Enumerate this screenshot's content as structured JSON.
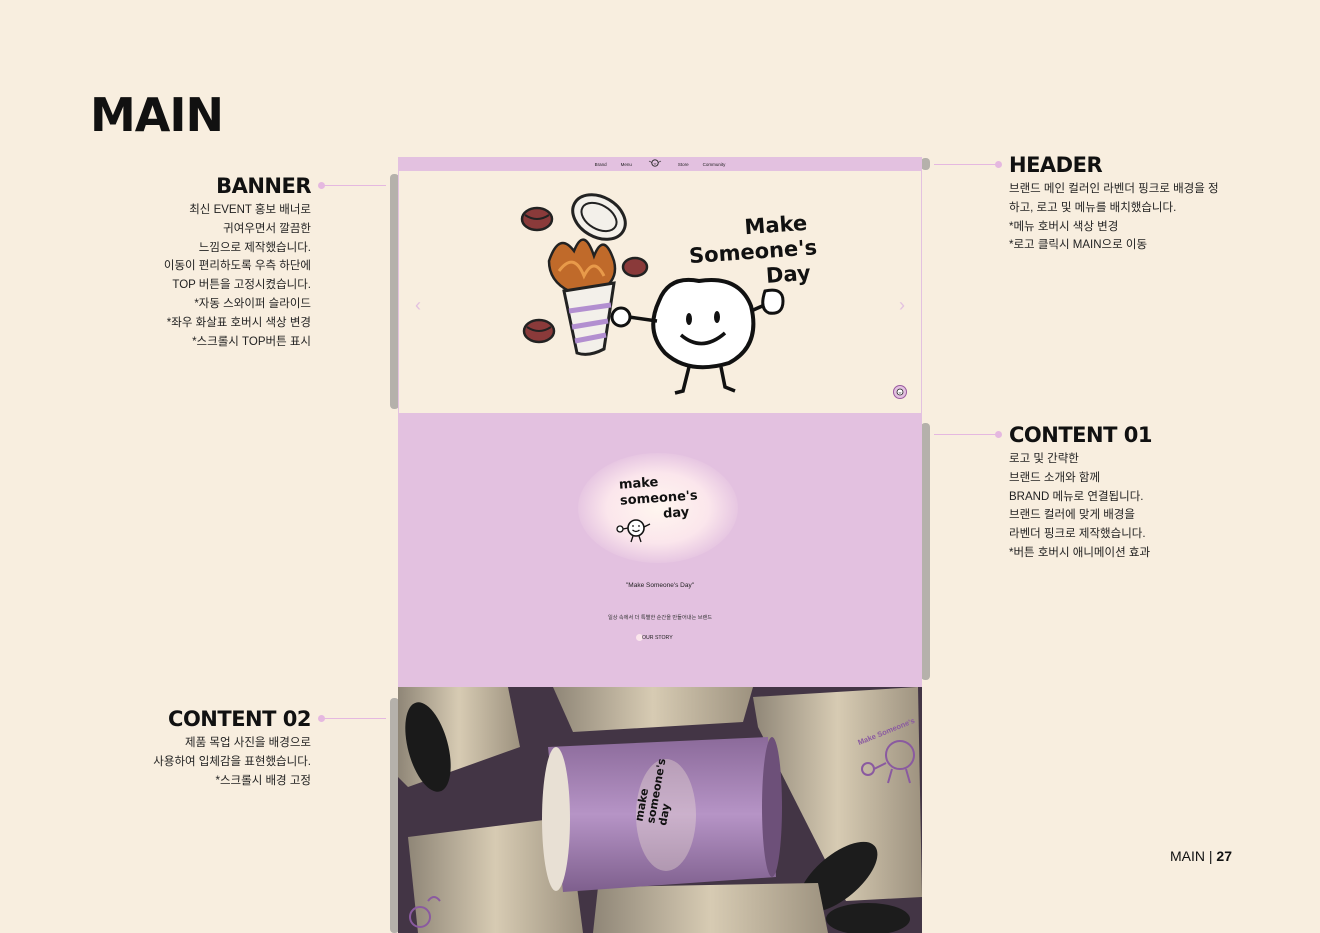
{
  "page": {
    "title": "MAIN",
    "footer_section": "MAIN",
    "footer_sep": "|",
    "footer_page": "27"
  },
  "banner_anno": {
    "title": "BANNER",
    "lines": [
      "최신 EVENT 홍보 배너로",
      "귀여우면서 깔끔한",
      "느낌으로 제작했습니다.",
      "이동이 편리하도록 우측 하단에",
      "TOP 버튼을 고정시켰습니다.",
      "*자동 스와이퍼 슬라이드",
      "*좌우 화살표 호버시 색상 변경",
      "*스크롤시 TOP버튼 표시"
    ]
  },
  "content02_anno": {
    "title": "CONTENT 02",
    "lines": [
      "제품 목업 사진을 배경으로",
      "사용하여 입체감을 표현했습니다.",
      "*스크롤시 배경 고정"
    ]
  },
  "header_anno": {
    "title": "HEADER",
    "lines": [
      "브랜드 메인 컬러인 라벤더 핑크로 배경을 정",
      "하고, 로고 및 메뉴를 배치했습니다.",
      "*메뉴 호버시 색상 변경",
      "*로고 클릭시 MAIN으로 이동"
    ]
  },
  "content01_anno": {
    "title": "CONTENT 01",
    "lines": [
      "로고 및 간략한",
      "브랜드 소개와 함께",
      "BRAND 메뉴로 연결됩니다.",
      "브랜드 컬러에 맞게 배경을",
      "라벤더 핑크로 제작했습니다.",
      "*버튼 호버시 애니메이션 효과"
    ]
  },
  "mock": {
    "nav": {
      "brand": "Brand",
      "menu": "Menu",
      "store": "Store",
      "community": "Community"
    },
    "banner": {
      "slogan_lines": [
        "Make",
        "Someone's",
        "Day"
      ],
      "prev": "‹",
      "next": "›"
    },
    "content1": {
      "logo_lines": [
        "make",
        "someone's",
        "day"
      ],
      "quote": "\"Make Someone's Day\"",
      "sub": "일상 속에서 더 특별한 순간을 만들어내는 브랜드",
      "button": "OUR STORY"
    },
    "content2": {
      "cup_text_lines": [
        "make",
        "someone's",
        "day"
      ],
      "side_text": "Make Someone's"
    }
  },
  "colors": {
    "background": "#f8eedf",
    "lavender": "#e3c1e0",
    "accent_line": "#e5b8e0",
    "cup_purple": "#a985b6",
    "cup_beige": "#cbbfa8"
  }
}
